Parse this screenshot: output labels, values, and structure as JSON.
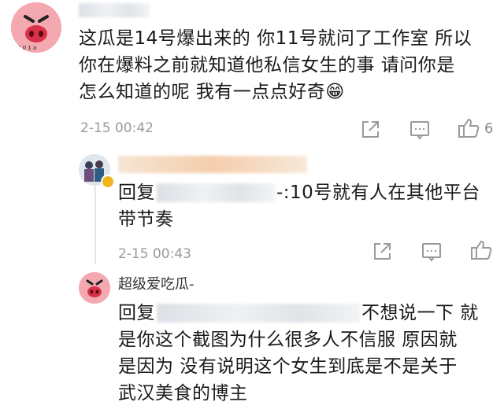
{
  "comment1": {
    "text_lines": [
      "这瓜是14号爆出来的 你11号就问了工作室 所以",
      "你在爆料之前就知道他私信女生的事 请问你是",
      "怎么知道的呢 我有一点点好奇😁"
    ],
    "time": "2-15 00:42",
    "like_count": "6"
  },
  "reply1": {
    "prefix": "回复",
    "text_tail": "-:10号就有人在其他平台",
    "text_line2": "带节奏",
    "time": "2-15 00:43"
  },
  "reply2": {
    "username": "超级爱吃瓜-",
    "prefix": "回复",
    "line1_tail": "不想说一下 就",
    "line2": "是你这个截图为什么很多人不信服 原因就",
    "line3": "是因为 没有说明这个女生到底是不是关于",
    "line4": "武汉美食的博主"
  },
  "icons": {
    "share": "share-icon",
    "comment": "comment-icon",
    "like": "thumbs-up-icon"
  }
}
